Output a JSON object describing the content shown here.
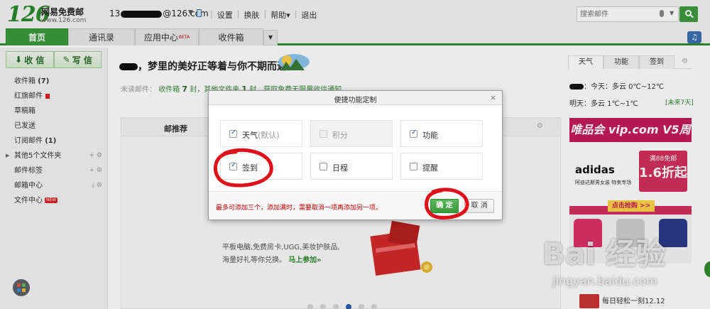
{
  "header": {
    "logo_number": "126",
    "logo_name": "网易免费邮",
    "logo_url": "www.126.com",
    "account_prefix": "13",
    "account_suffix": "@126.com",
    "links": [
      "设置",
      "换肤",
      "帮助▾",
      "退出"
    ],
    "search_placeholder": "搜索邮件"
  },
  "nav": {
    "tabs": [
      "首页",
      "通讯录",
      "应用中心",
      "收件箱"
    ],
    "active_tab": "首页",
    "beta_label": "BETA"
  },
  "sidebar": {
    "receive_label": "收 信",
    "write_label": "写 信",
    "items": [
      {
        "label": "收件箱",
        "count": "(7)"
      },
      {
        "label": "红旗邮件",
        "count": ""
      },
      {
        "label": "草稿箱",
        "count": ""
      },
      {
        "label": "已发送",
        "count": ""
      },
      {
        "label": "订阅邮件",
        "count": "(1)"
      },
      {
        "label": "其他5个文件夹",
        "count": ""
      },
      {
        "label": "邮件标签",
        "count": ""
      },
      {
        "label": "邮箱中心",
        "count": ""
      },
      {
        "label": "文件中心",
        "count": ""
      }
    ],
    "new_badge": "NEW"
  },
  "main": {
    "greeting": "，梦里的美好正等着与你不期而遇。",
    "unread_prefix": "未读邮件：",
    "unread_inbox_label": "收件箱",
    "unread_inbox_count": "7",
    "unread_unit": "封",
    "unread_other_label": "，其他文件夹",
    "unread_other_count": "1",
    "unread_other_unit": "封",
    "unread_cta": "，获取免费无限量收信通知",
    "panel_title": "邮推荐",
    "promo_line1": "平板电脑,免费房卡,UGG,美妆护肤品,",
    "promo_line2_prefix": "海量好礼等你兑换。",
    "promo_link": "马上参加»"
  },
  "right": {
    "tabs": [
      "天气",
      "功能",
      "签到"
    ],
    "active_tab": "天气",
    "today": "：今天：多云 0℃~12℃",
    "tomorrow": "明天：多云 1℃~1℃",
    "future_link": "[未来7天]",
    "ad_title": "唯品会 vip.com V5周年庆",
    "ad_brand": "adidas",
    "ad_brand_sub": "阿迪达斯男女装 特卖专场",
    "ad_tag_line1": "满88免邮",
    "ad_tag_line2": "1.6折起",
    "ad_button": "点击抢购 >>",
    "news": "每日轻松一刻12.12"
  },
  "modal": {
    "title": "便捷功能定制",
    "options": [
      {
        "label": "天气",
        "suffix": "(默认)",
        "checked": true,
        "disabled": false
      },
      {
        "label": "积分",
        "suffix": "",
        "checked": false,
        "disabled": true
      },
      {
        "label": "功能",
        "suffix": "",
        "checked": true,
        "disabled": false
      },
      {
        "label": "签到",
        "suffix": "",
        "checked": true,
        "disabled": false
      },
      {
        "label": "日程",
        "suffix": "",
        "checked": false,
        "disabled": false
      },
      {
        "label": "提醒",
        "suffix": "",
        "checked": false,
        "disabled": false
      }
    ],
    "note": "最多可添加三个，添加满时，需要取消一项再添加另一项。",
    "ok_label": "确 定",
    "cancel_label": "取 消",
    "close_glyph": "×"
  },
  "watermark": {
    "brand": "Bai 经验",
    "url": "jingyan.baidu.com"
  },
  "colors": {
    "brand_green": "#3a9a3a",
    "annotation_red": "#e0101a",
    "link_blue": "#2a5db0"
  }
}
